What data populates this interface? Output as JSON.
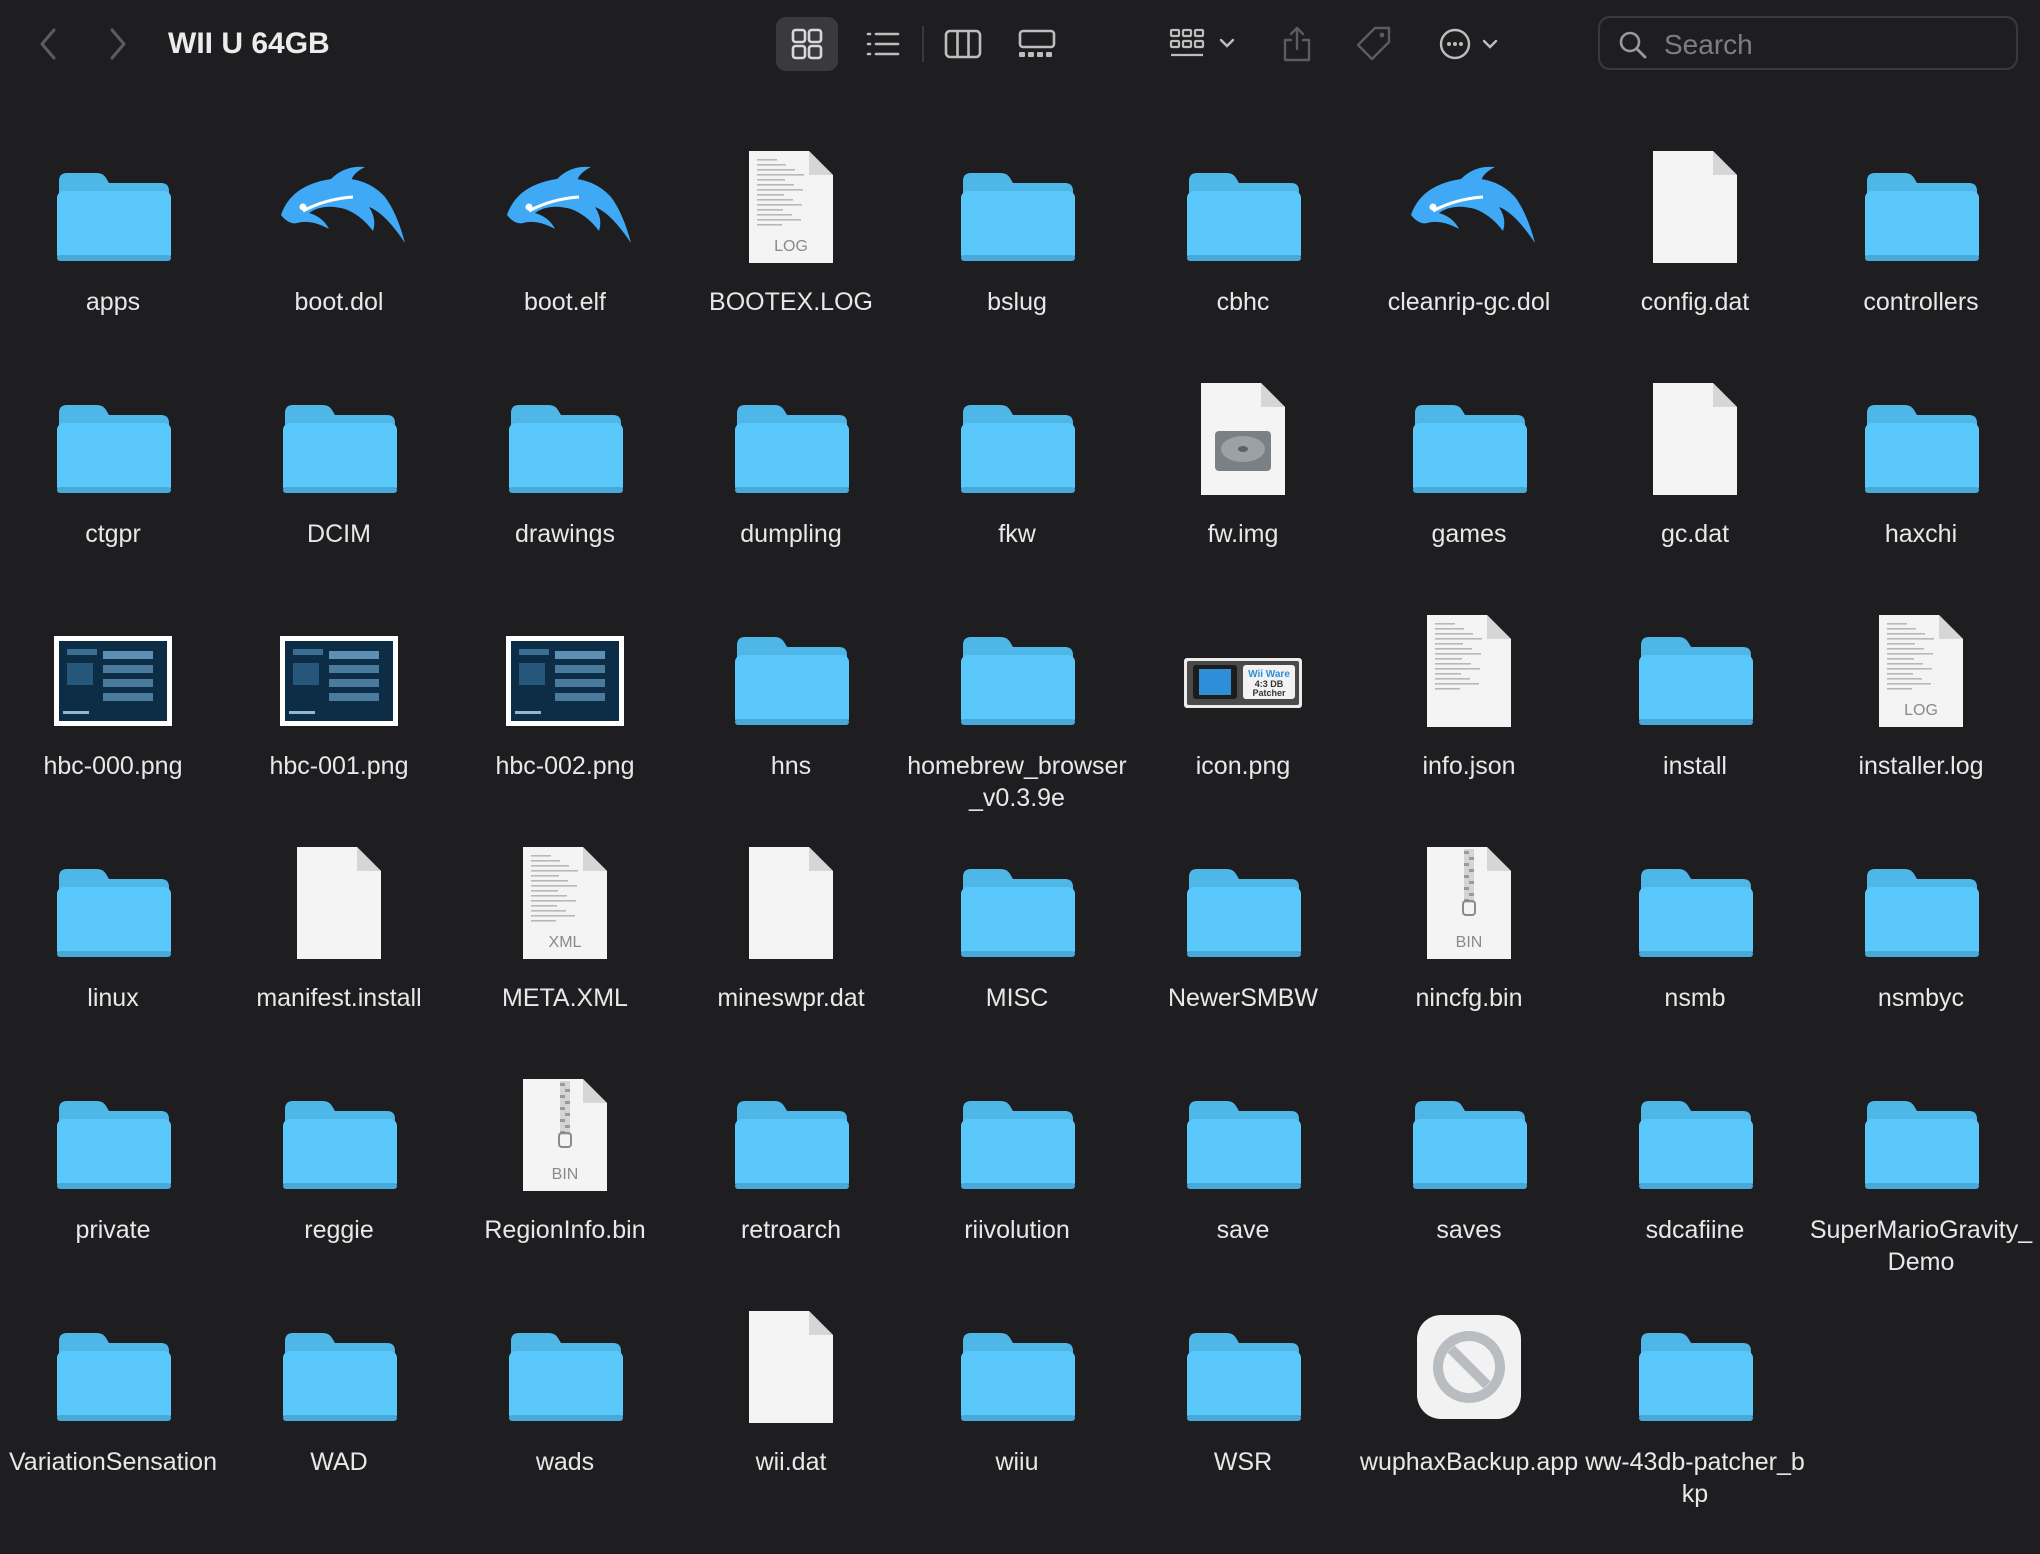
{
  "window": {
    "title": "WII U 64GB",
    "search_placeholder": "Search"
  },
  "colors": {
    "background": "#1e1e21",
    "folder": "#5ac8fa",
    "folder_tab": "#4fb6e8",
    "dolphin": "#3fa9f5"
  },
  "files": [
    {
      "name": "apps",
      "icon": "folder"
    },
    {
      "name": "boot.dol",
      "icon": "dolphin"
    },
    {
      "name": "boot.elf",
      "icon": "dolphin"
    },
    {
      "name": "BOOTEX.LOG",
      "icon": "log"
    },
    {
      "name": "bslug",
      "icon": "folder"
    },
    {
      "name": "cbhc",
      "icon": "folder"
    },
    {
      "name": "cleanrip-gc.dol",
      "icon": "dolphin"
    },
    {
      "name": "config.dat",
      "icon": "doc"
    },
    {
      "name": "controllers",
      "icon": "folder"
    },
    {
      "name": "ctgpr",
      "icon": "folder"
    },
    {
      "name": "DCIM",
      "icon": "folder"
    },
    {
      "name": "drawings",
      "icon": "folder"
    },
    {
      "name": "dumpling",
      "icon": "folder"
    },
    {
      "name": "fkw",
      "icon": "folder"
    },
    {
      "name": "fw.img",
      "icon": "disk"
    },
    {
      "name": "games",
      "icon": "folder"
    },
    {
      "name": "gc.dat",
      "icon": "doc"
    },
    {
      "name": "haxchi",
      "icon": "folder"
    },
    {
      "name": "hbc-000.png",
      "icon": "thumb"
    },
    {
      "name": "hbc-001.png",
      "icon": "thumb"
    },
    {
      "name": "hbc-002.png",
      "icon": "thumb"
    },
    {
      "name": "hns",
      "icon": "folder"
    },
    {
      "name": "homebrew_browser_v0.3.9e",
      "icon": "folder"
    },
    {
      "name": "icon.png",
      "icon": "banner",
      "badge": "Wii Ware 4:3 DB Patcher"
    },
    {
      "name": "info.json",
      "icon": "doc-text"
    },
    {
      "name": "install",
      "icon": "folder"
    },
    {
      "name": "installer.log",
      "icon": "log"
    },
    {
      "name": "linux",
      "icon": "folder"
    },
    {
      "name": "manifest.install",
      "icon": "doc"
    },
    {
      "name": "META.XML",
      "icon": "xml",
      "tag": "XML"
    },
    {
      "name": "mineswpr.dat",
      "icon": "doc"
    },
    {
      "name": "MISC",
      "icon": "folder"
    },
    {
      "name": "NewerSMBW",
      "icon": "folder"
    },
    {
      "name": "nincfg.bin",
      "icon": "bin",
      "tag": "BIN"
    },
    {
      "name": "nsmb",
      "icon": "folder"
    },
    {
      "name": "nsmbyc",
      "icon": "folder"
    },
    {
      "name": "private",
      "icon": "folder"
    },
    {
      "name": "reggie",
      "icon": "folder"
    },
    {
      "name": "RegionInfo.bin",
      "icon": "bin",
      "tag": "BIN"
    },
    {
      "name": "retroarch",
      "icon": "folder"
    },
    {
      "name": "riivolution",
      "icon": "folder"
    },
    {
      "name": "save",
      "icon": "folder"
    },
    {
      "name": "saves",
      "icon": "folder"
    },
    {
      "name": "sdcafiine",
      "icon": "folder"
    },
    {
      "name": "SuperMarioGravity_Demo",
      "icon": "folder"
    },
    {
      "name": "VariationSensation",
      "icon": "folder"
    },
    {
      "name": "WAD",
      "icon": "folder"
    },
    {
      "name": "wads",
      "icon": "folder"
    },
    {
      "name": "wii.dat",
      "icon": "doc"
    },
    {
      "name": "wiiu",
      "icon": "folder"
    },
    {
      "name": "WSR",
      "icon": "folder"
    },
    {
      "name": "wuphaxBackup.app",
      "icon": "app-blocked"
    },
    {
      "name": "ww-43db-patcher_bkp",
      "icon": "folder"
    }
  ],
  "log_tag": "LOG"
}
